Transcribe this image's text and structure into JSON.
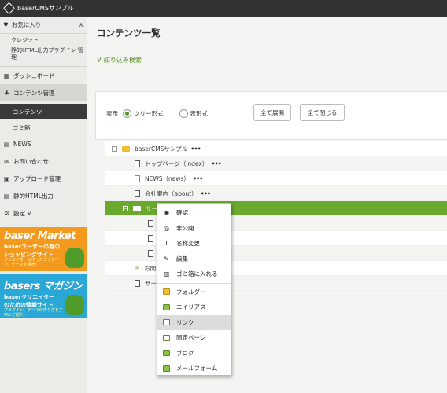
{
  "app": {
    "title": "baserCMSサンプル"
  },
  "sidebar": {
    "favorites": {
      "label": "お気に入り",
      "items": [
        "クレジット",
        "静的HTML出力プラグイン 管理"
      ]
    },
    "items": [
      {
        "label": "ダッシュボード",
        "icon": "dashboard-icon",
        "glyph": "▦"
      },
      {
        "label": "コンテンツ管理",
        "icon": "sitemap-icon",
        "glyph": "♣"
      }
    ],
    "sub": [
      "コンテンツ",
      "ゴミ箱"
    ],
    "items2": [
      {
        "label": "NEWS",
        "icon": "doc-icon",
        "glyph": "▤"
      },
      {
        "label": "お問い合わせ",
        "icon": "mail-icon",
        "glyph": "✉"
      },
      {
        "label": "アップロード管理",
        "icon": "upload-icon",
        "glyph": "▣"
      },
      {
        "label": "静的HTML出力",
        "icon": "file-icon",
        "glyph": "▤"
      },
      {
        "label": "設定 ∨",
        "icon": "gear-icon",
        "glyph": "✲"
      }
    ],
    "banner1": {
      "title": "baser Market",
      "line1": "baserユーザーの為の",
      "line2": "ショッピングサイト",
      "line3": "クリエイターが作ったプラグイン、テーマを販売!"
    },
    "banner2": {
      "title": "basers マガジン",
      "line1": "baserクリエイター",
      "line2": "のための情報サイト",
      "line3": "プラグイン、テーマの作り方を丁寧にご紹介!"
    }
  },
  "main": {
    "title": "コンテンツ一覧",
    "filter": "絞り込み検索",
    "view_label": "表示",
    "view_options": [
      "ツリー形式",
      "表形式"
    ],
    "expand_all": "全て展開",
    "collapse_all": "全て閉じる"
  },
  "tree": [
    {
      "label": "baserCMSサンプル",
      "dots": "•••"
    },
    {
      "label": "トップページ（index）",
      "dots": "•••"
    },
    {
      "label": "NEWS（news）",
      "dots": "•••"
    },
    {
      "label": "会社案内（about）",
      "dots": "•••"
    },
    {
      "label": "サービス（service）",
      "dots": ""
    },
    {
      "label": "",
      "dots": ""
    },
    {
      "label": "",
      "dots": ""
    },
    {
      "label": "",
      "dots": ""
    },
    {
      "label": "お問",
      "dots": ""
    },
    {
      "label": "サー",
      "dots": ""
    }
  ],
  "context_menu": [
    {
      "label": "確認",
      "icon": "eye-icon",
      "glyph": "◉"
    },
    {
      "label": "非公開",
      "icon": "unpublish-icon",
      "glyph": "◎"
    },
    {
      "label": "名称変更",
      "icon": "rename-icon",
      "glyph": "I"
    },
    {
      "label": "編集",
      "icon": "edit-icon",
      "glyph": "✎"
    },
    {
      "label": "ゴミ箱に入れる",
      "icon": "trash-icon",
      "glyph": "▥"
    },
    {
      "label": "フォルダー",
      "icon": "add-folder-icon",
      "glyph": ""
    },
    {
      "label": "エイリアス",
      "icon": "add-alias-icon",
      "glyph": ""
    },
    {
      "label": "リンク",
      "icon": "add-link-icon",
      "glyph": ""
    },
    {
      "label": "固定ページ",
      "icon": "add-page-icon",
      "glyph": ""
    },
    {
      "label": "ブログ",
      "icon": "add-blog-icon",
      "glyph": ""
    },
    {
      "label": "メールフォーム",
      "icon": "add-mail-icon",
      "glyph": ""
    }
  ],
  "colors": {
    "accent": "#6aa82e",
    "topbar": "#333333",
    "banner1": "#f39a1e",
    "banner2": "#29a7d6"
  }
}
